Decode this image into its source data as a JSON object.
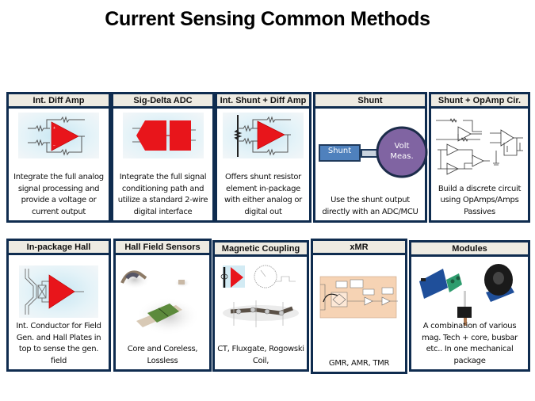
{
  "title": "Current Sensing Common Methods",
  "colors": {
    "border": "#0f2c4f",
    "header_bg": "#eeebe2",
    "amp_red": "#e8151b",
    "shunt_box": "#4f81bd",
    "volt_circle": "#8064a2"
  },
  "row1": [
    {
      "header": "Int. Diff Amp",
      "description": "Integrate the full analog signal processing and provide a voltage or current output",
      "image": "diff-amp-schematic"
    },
    {
      "header": "Sig-Delta ADC",
      "description": "Integrate the full signal conditioning path and utilize a standard 2-wire digital interface",
      "image": "sigma-delta-adc-block"
    },
    {
      "header": "Int. Shunt + Diff Amp",
      "description": "Offers shunt resistor element in-package with either analog or digital out",
      "image": "shunt-diff-amp-schematic"
    },
    {
      "header": "Shunt",
      "description": "Use the shunt output directly with an ADC/MCU",
      "image": "shunt-volt-diagram",
      "diagram": {
        "box_label": "Shunt",
        "circle_label_line1": "Volt",
        "circle_label_line2": "Meas."
      }
    },
    {
      "header": "Shunt + OpAmp Cir.",
      "description": "Build a discrete circuit using OpAmps/Amps Passives",
      "image": "opamp-circuits-schematic"
    }
  ],
  "row2": [
    {
      "header": "In-package Hall",
      "description": "Int. Conductor for Field Gen. and Hall Plates in top to sense the gen. field",
      "image": "in-package-hall-schematic"
    },
    {
      "header": "Hall Field Sensors",
      "description": "Core and Coreless, Lossless",
      "image": "hall-sensor-photos"
    },
    {
      "header": "Magnetic Coupling",
      "description": "CT, Fluxgate, Rogowski Coil,",
      "image": "magnetic-coupling-images"
    },
    {
      "header": "xMR",
      "description": "GMR, AMR, TMR",
      "image": "xmr-block-diagram"
    },
    {
      "header": "Modules",
      "description": "A combination of various mag. Tech + core, busbar etc.. In one mechanical package",
      "image": "module-photos"
    }
  ]
}
